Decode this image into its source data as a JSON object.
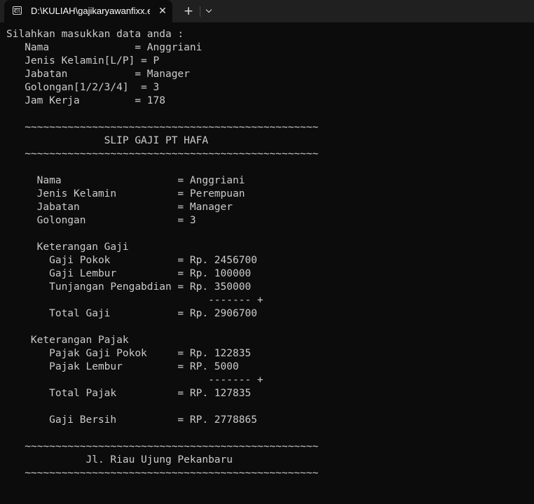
{
  "window": {
    "tab_title": "D:\\KULIAH\\gajikaryawanfixx.exe",
    "tab_icon": "C:\\",
    "close_glyph": "✕",
    "new_tab_glyph": "+"
  },
  "console": {
    "lines": [
      "Silahkan masukkan data anda :",
      "   Nama              = Anggriani",
      "   Jenis Kelamin[L/P] = P",
      "   Jabatan           = Manager",
      "   Golongan[1/2/3/4]  = 3",
      "   Jam Kerja         = 178",
      "",
      "   ~~~~~~~~~~~~~~~~~~~~~~~~~~~~~~~~~~~~~~~~~~~~~~~~",
      "                SLIP GAJI PT HAFA",
      "   ~~~~~~~~~~~~~~~~~~~~~~~~~~~~~~~~~~~~~~~~~~~~~~~~",
      "",
      "     Nama                   = Anggriani",
      "     Jenis Kelamin          = Perempuan",
      "     Jabatan                = Manager",
      "     Golongan               = 3",
      "",
      "     Keterangan Gaji",
      "       Gaji Pokok           = Rp. 2456700",
      "       Gaji Lembur          = Rp. 100000",
      "       Tunjangan Pengabdian = Rp. 350000",
      "                                 ------- +",
      "       Total Gaji           = Rp. 2906700",
      "",
      "    Keterangan Pajak",
      "       Pajak Gaji Pokok     = Rp. 122835",
      "       Pajak Lembur         = RP. 5000",
      "                                 ------- +",
      "       Total Pajak          = RP. 127835",
      "",
      "       Gaji Bersih          = RP. 2778865",
      "",
      "   ~~~~~~~~~~~~~~~~~~~~~~~~~~~~~~~~~~~~~~~~~~~~~~~~",
      "             Jl. Riau Ujung Pekanbaru",
      "   ~~~~~~~~~~~~~~~~~~~~~~~~~~~~~~~~~~~~~~~~~~~~~~~~"
    ]
  }
}
